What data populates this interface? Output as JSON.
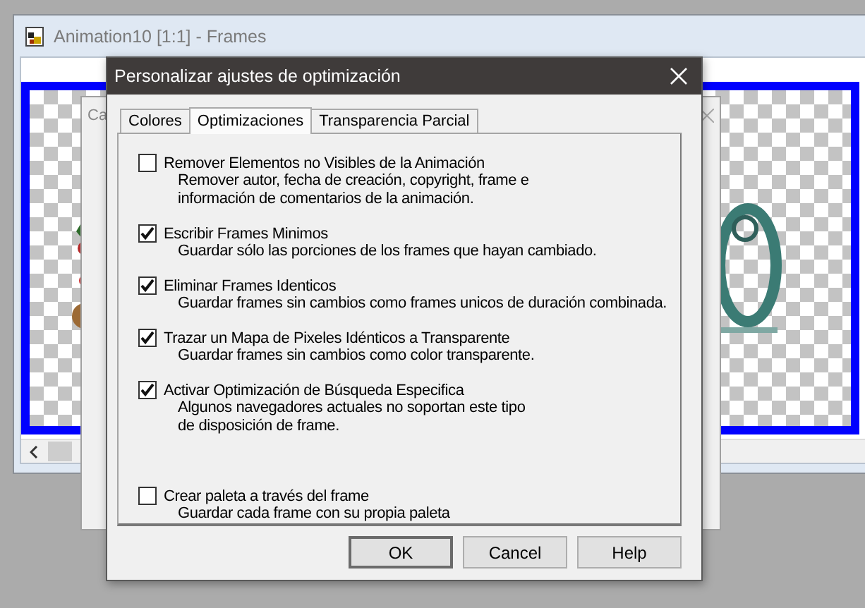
{
  "background_window": {
    "title": "Animation10 [1:1] - Frames"
  },
  "hidden_dialog": {
    "title": "Ca"
  },
  "dialog": {
    "title": "Personalizar ajustes de optimización",
    "tabs": [
      {
        "label": "Colores",
        "selected": false
      },
      {
        "label": "Optimizaciones",
        "selected": true
      },
      {
        "label": "Transparencia Parcial",
        "selected": false
      }
    ],
    "options": [
      {
        "label": "Remover Elementos no Visibles de la Animación",
        "checked": false,
        "description": [
          "Remover autor, fecha de creación, copyright, frame e",
          "información de comentarios de la animación."
        ]
      },
      {
        "label": "Escribir Frames Minimos",
        "checked": true,
        "description": [
          "Guardar sólo las porciones de los frames que hayan cambiado."
        ]
      },
      {
        "label": "Eliminar Frames Identicos",
        "checked": true,
        "description": [
          "Guardar frames sin cambios como frames unicos de duración combinada."
        ]
      },
      {
        "label": "Trazar un Mapa de Pixeles Idénticos a Transparente",
        "checked": true,
        "description": [
          "Guardar frames sin cambios como color transparente."
        ]
      },
      {
        "label": "Activar Optimización de Búsqueda Especifica",
        "checked": true,
        "description": [
          "Algunos navegadores actuales no soportan este tipo",
          "de disposición de frame."
        ]
      }
    ],
    "bottom_option": {
      "label": "Crear paleta a través del frame",
      "checked": false,
      "description": [
        "Guardar cada frame con su propia paleta"
      ]
    },
    "buttons": [
      {
        "label": "OK",
        "default": true
      },
      {
        "label": "Cancel",
        "default": false
      },
      {
        "label": "Help",
        "default": false
      }
    ]
  }
}
